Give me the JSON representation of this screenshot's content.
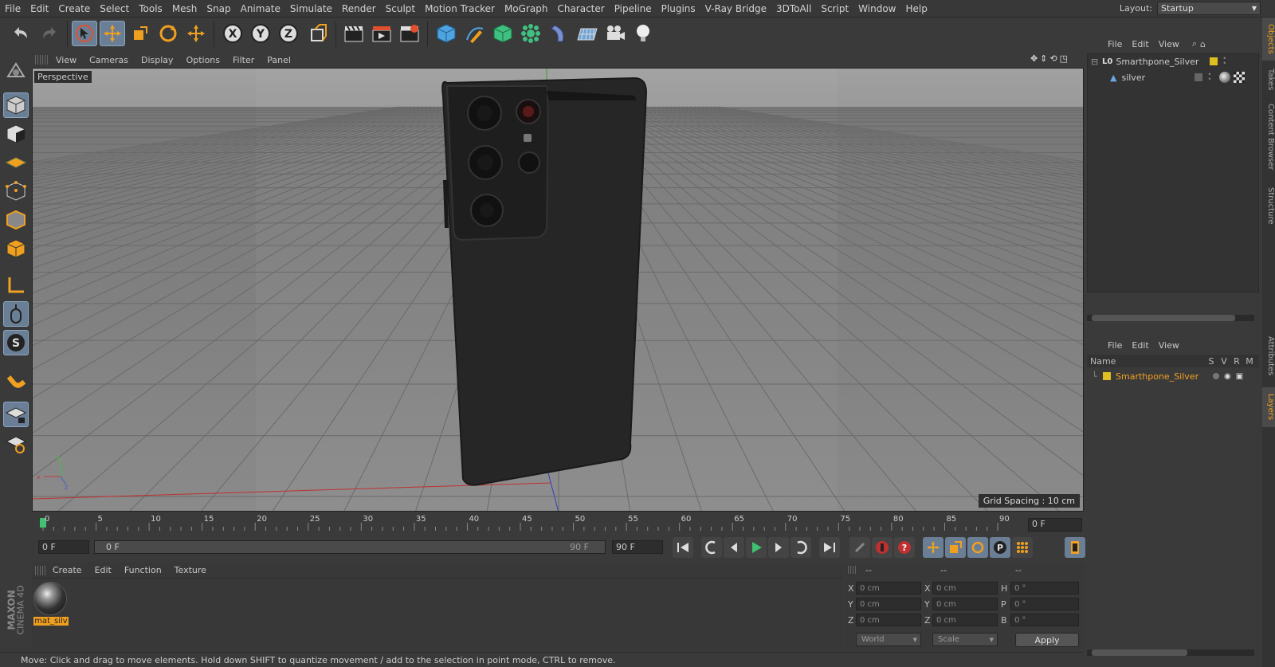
{
  "menu": [
    "File",
    "Edit",
    "Create",
    "Select",
    "Tools",
    "Mesh",
    "Snap",
    "Animate",
    "Simulate",
    "Render",
    "Sculpt",
    "Motion Tracker",
    "MoGraph",
    "Character",
    "Pipeline",
    "Plugins",
    "V-Ray Bridge",
    "3DToAll",
    "Script",
    "Window",
    "Help"
  ],
  "layout": {
    "label": "Layout:",
    "value": "Startup"
  },
  "viewport": {
    "menu": [
      "View",
      "Cameras",
      "Display",
      "Options",
      "Filter",
      "Panel"
    ],
    "label": "Perspective",
    "grid_spacing": "Grid Spacing : 10 cm"
  },
  "timeline": {
    "ticks": [
      "0",
      "5",
      "10",
      "15",
      "20",
      "25",
      "30",
      "35",
      "40",
      "45",
      "50",
      "55",
      "60",
      "65",
      "70",
      "75",
      "80",
      "85",
      "90"
    ],
    "current_frame": "0 F"
  },
  "transport": {
    "start_frame": "0 F",
    "range_start": "0 F",
    "range_end": "90 F",
    "end_frame": "90 F"
  },
  "materials": {
    "menu": [
      "Create",
      "Edit",
      "Function",
      "Texture"
    ],
    "item": "mat_silv"
  },
  "coordinates": {
    "header": [
      "--",
      "--",
      "--"
    ],
    "rows": [
      {
        "a": "X",
        "av": "0 cm",
        "b": "X",
        "bv": "0 cm",
        "c": "H",
        "cv": "0 °"
      },
      {
        "a": "Y",
        "av": "0 cm",
        "b": "Y",
        "bv": "0 cm",
        "c": "P",
        "cv": "0 °"
      },
      {
        "a": "Z",
        "av": "0 cm",
        "b": "Z",
        "bv": "0 cm",
        "c": "B",
        "cv": "0 °"
      }
    ],
    "space": "World",
    "mode": "Scale",
    "apply": "Apply"
  },
  "objects": {
    "menu": [
      "File",
      "Edit",
      "View"
    ],
    "items": [
      {
        "name": "Smarthpone_Silver"
      },
      {
        "name": "silver"
      }
    ]
  },
  "layers": {
    "menu": [
      "File",
      "Edit",
      "View"
    ],
    "columns": [
      "Name",
      "S",
      "V",
      "R",
      "M"
    ],
    "items": [
      {
        "name": "Smarthpone_Silver",
        "color": "#e0c020"
      }
    ]
  },
  "side_tabs": [
    "Objects",
    "Takes",
    "Content Browser",
    "Structure",
    "Attributes",
    "Layers"
  ],
  "status": "Move: Click and drag to move elements. Hold down SHIFT to quantize movement / add to the selection in point mode, CTRL to remove.",
  "branding": {
    "line1": "MAXON",
    "line2": "CINEMA 4D"
  },
  "colors": {
    "accent": "#f0a020",
    "tool_active": "#6a7f95",
    "layer": "#e0c020"
  }
}
